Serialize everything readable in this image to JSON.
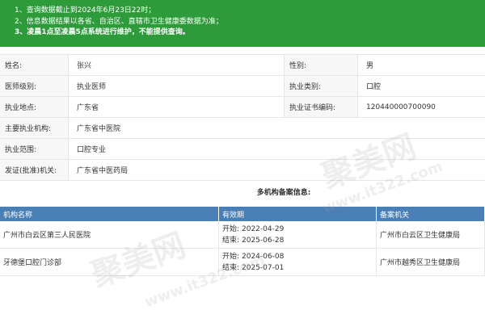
{
  "notice": {
    "line1": "1、查询数据截止到2024年6月23日22时；",
    "line2": "2、信息数据结果以各省、自治区、直辖市卫生健康委数据为准；",
    "line3": "3、凌晨1点至凌晨5点系统进行维护，不能提供查询。"
  },
  "info": {
    "name_label": "姓名:",
    "name_value": "张兴",
    "gender_label": "性别:",
    "gender_value": "男",
    "level_label": "医师级别:",
    "level_value": "执业医师",
    "category_label": "执业类别:",
    "category_value": "口腔",
    "location_label": "执业地点:",
    "location_value": "广东省",
    "cert_label": "执业证书编码:",
    "cert_value": "120440000700090",
    "org_label": "主要执业机构:",
    "org_value": "广东省中医院",
    "scope_label": "执业范围:",
    "scope_value": "口腔专业",
    "issuer_label": "发证(批准)机关:",
    "issuer_value": "广东省中医药局"
  },
  "multi": {
    "title": "多机构备案信息:",
    "headers": {
      "name": "机构名称",
      "validity": "有效期",
      "authority": "备案机关"
    },
    "start_label": "开始:",
    "end_label": "结束:",
    "rows": [
      {
        "name": "广州市白云区第三人民医院",
        "start": "2022-04-29",
        "end": "2025-06-28",
        "authority": "广州市白云区卫生健康局"
      },
      {
        "name": "牙德堡口腔门诊部",
        "start": "2024-06-08",
        "end": "2025-07-01",
        "authority": "广州市越秀区卫生健康局"
      }
    ]
  },
  "watermark": {
    "text1": "聚美网",
    "text2": "www.it322.com"
  }
}
